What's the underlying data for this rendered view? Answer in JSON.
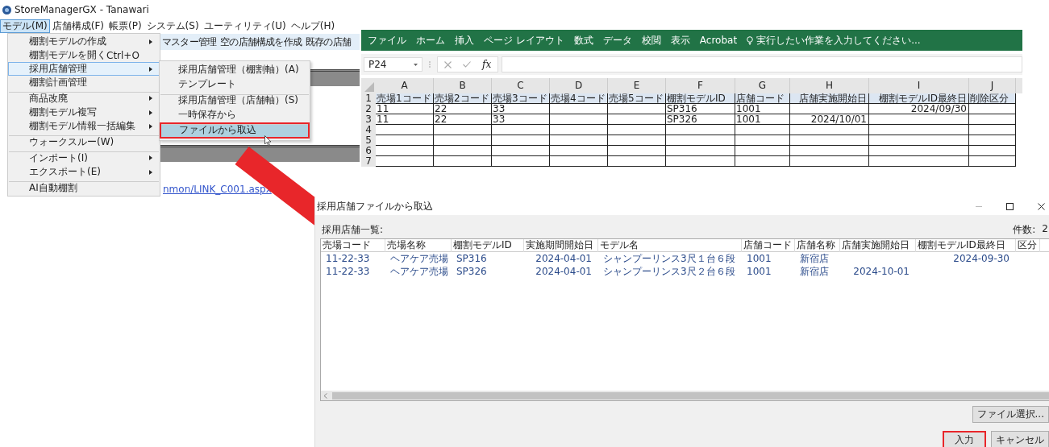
{
  "app_window": {
    "title": "StoreManagerGX - Tanawari",
    "menu_bar": [
      {
        "label": "モデル(M)",
        "selected": true
      },
      {
        "label": "店舗構成(F)",
        "selected": false
      },
      {
        "label": "帳票(P)",
        "selected": false
      },
      {
        "label": "システム(S)",
        "selected": false
      },
      {
        "label": "ユーティリティ(U)",
        "selected": false
      },
      {
        "label": "ヘルプ(H)",
        "selected": false
      }
    ],
    "toolbar_links": [
      "マスター管理",
      "空の店舗構成を作成",
      "既存の店舗"
    ],
    "link_text": "nmon/LINK_C001.aspx",
    "menu": [
      {
        "label": "棚割モデルの作成",
        "has_submenu": true,
        "selected": false,
        "separator_before": false
      },
      {
        "label": "棚割モデルを開く",
        "shortcut": "Ctrl+O",
        "has_submenu": false,
        "selected": false,
        "separator_before": false
      },
      {
        "label": "採用店舗管理",
        "has_submenu": true,
        "selected": true,
        "separator_before": false
      },
      {
        "label": "棚割計画管理",
        "has_submenu": false,
        "selected": false,
        "separator_before": false
      },
      {
        "label": "商品改廃",
        "has_submenu": true,
        "selected": false,
        "separator_before": true
      },
      {
        "label": "棚割モデル複写",
        "has_submenu": true,
        "selected": false,
        "separator_before": false
      },
      {
        "label": "棚割モデル情報一括編集",
        "has_submenu": true,
        "selected": false,
        "separator_before": false
      },
      {
        "label": "ウォークスルー(W)",
        "has_submenu": false,
        "selected": false,
        "separator_before": true
      },
      {
        "label": "インポート(I)",
        "has_submenu": true,
        "selected": false,
        "separator_before": true
      },
      {
        "label": "エクスポート(E)",
        "has_submenu": true,
        "selected": false,
        "separator_before": false
      },
      {
        "label": "AI自動棚割",
        "has_submenu": false,
        "selected": false,
        "separator_before": true
      }
    ],
    "submenu": [
      {
        "label": "採用店舗管理（棚割軸）(A)",
        "selected": false,
        "highlighted": false,
        "separator_before": false
      },
      {
        "label": "テンプレート",
        "selected": false,
        "highlighted": false,
        "separator_before": false
      },
      {
        "label": "採用店舗管理（店舗軸）(S)",
        "selected": false,
        "highlighted": false,
        "separator_before": true
      },
      {
        "label": "一時保存から",
        "selected": false,
        "highlighted": false,
        "separator_before": false
      },
      {
        "label": "ファイルから取込",
        "selected": true,
        "highlighted": true,
        "separator_before": true
      }
    ]
  },
  "spreadsheet": {
    "ribbon_tabs": [
      "ファイル",
      "ホーム",
      "挿入",
      "ページ レイアウト",
      "数式",
      "データ",
      "校閲",
      "表示",
      "Acrobat"
    ],
    "tell_me": "実行したい作業を入力してください...",
    "name_box": "P24",
    "formula_label": "fx",
    "columns": [
      "A",
      "B",
      "C",
      "D",
      "E",
      "F",
      "G",
      "H",
      "I",
      "J"
    ],
    "rows": [
      {
        "number": "1",
        "kind": "header",
        "cells": [
          "売場1コード",
          "売場2コード",
          "売場3コード",
          "売場4コード",
          "売場5コード",
          "棚割モデルID",
          "店舗コード",
          "店舗実施開始日",
          "棚割モデルID最終日",
          "削除区分"
        ]
      },
      {
        "number": "2",
        "kind": "data",
        "cells": [
          "11",
          "22",
          "33",
          null,
          null,
          "SP316",
          "1001",
          null,
          "2024/09/30",
          null
        ]
      },
      {
        "number": "3",
        "kind": "data",
        "cells": [
          "11",
          "22",
          "33",
          null,
          null,
          "SP326",
          "1001",
          "2024/10/01",
          null,
          null
        ]
      },
      {
        "number": "4",
        "kind": "data",
        "cells": [
          null,
          null,
          null,
          null,
          null,
          null,
          null,
          null,
          null,
          null
        ]
      },
      {
        "number": "5",
        "kind": "data",
        "cells": [
          null,
          null,
          null,
          null,
          null,
          null,
          null,
          null,
          null,
          null
        ]
      },
      {
        "number": "6",
        "kind": "data",
        "cells": [
          null,
          null,
          null,
          null,
          null,
          null,
          null,
          null,
          null,
          null
        ]
      },
      {
        "number": "7",
        "kind": "data",
        "cells": [
          null,
          null,
          null,
          null,
          null,
          null,
          null,
          null,
          null,
          null
        ]
      }
    ]
  },
  "dialog": {
    "title": "採用店舗ファイルから取込",
    "list_label": "採用店舗一覧:",
    "count_label": "件数:",
    "count": "2",
    "columns": [
      "売場コード",
      "売場名称",
      "棚割モデルID",
      "実施期間開始日",
      "モデル名",
      "店舗コード",
      "店舗名称",
      "店舗実施開始日",
      "棚割モデルID最終日",
      "区分"
    ],
    "rows": [
      [
        "11-22-33",
        "ヘアケア売場",
        "SP316",
        "2024-04-01",
        "シャンプーリンス3尺１台６段",
        "1001",
        "新宿店",
        null,
        "2024-09-30",
        null
      ],
      [
        "11-22-33",
        "ヘアケア売場",
        "SP326",
        "2024-04-01",
        "シャンプーリンス3尺２台６段",
        "1001",
        "新宿店",
        "2024-10-01",
        null,
        null
      ]
    ],
    "file_button": "ファイル選択...",
    "buttons": [
      {
        "label": "入力",
        "highlighted": true
      },
      {
        "label": "キャンセル",
        "highlighted": false
      }
    ]
  }
}
